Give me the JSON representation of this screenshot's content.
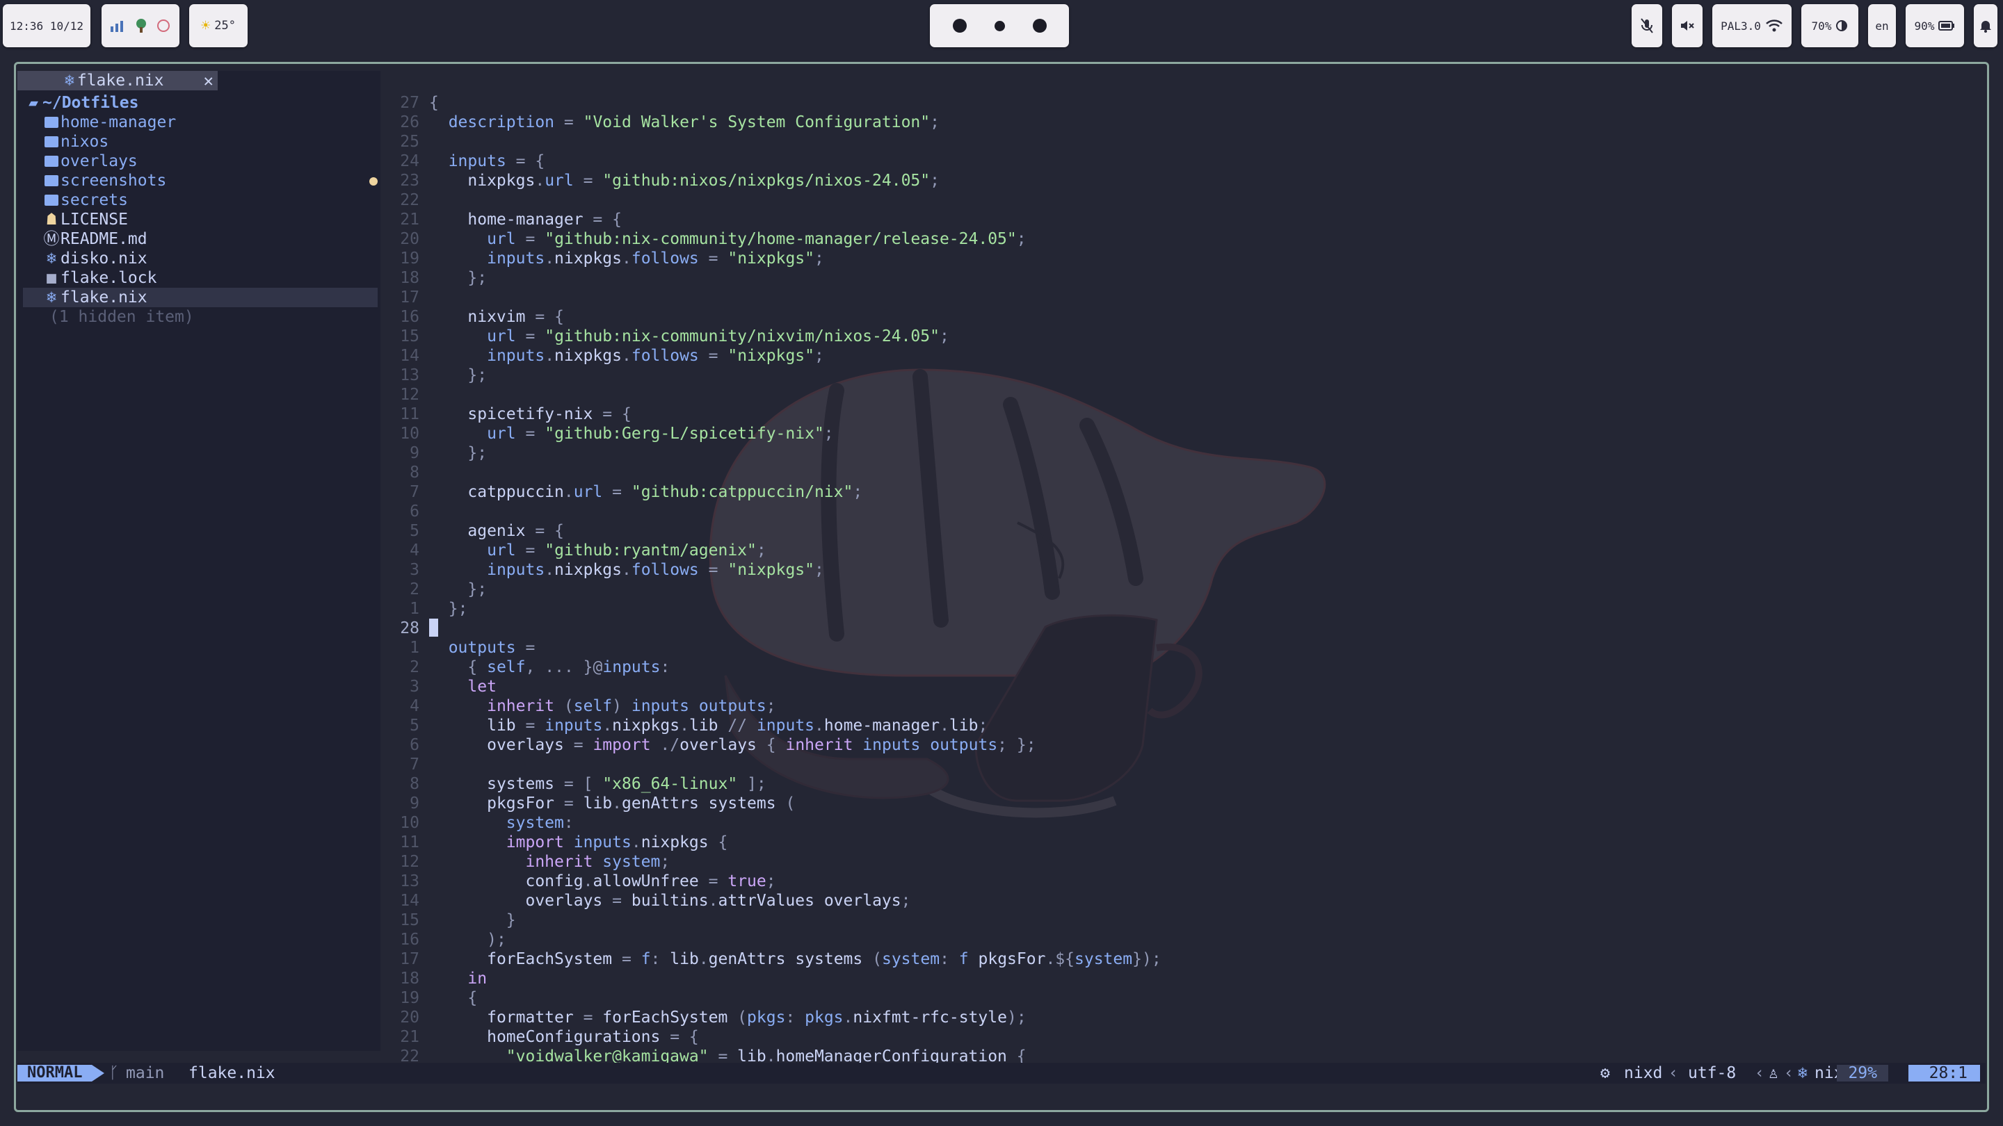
{
  "topbar": {
    "clock": "12:36 10/12",
    "weather": "25°",
    "network": "PAL3.0",
    "brightness": "70%",
    "language": "en",
    "battery": "90%"
  },
  "tab": {
    "title": "flake.nix"
  },
  "tree": [
    {
      "name": "~/Dotfiles",
      "type": "root"
    },
    {
      "name": "home-manager",
      "type": "folder"
    },
    {
      "name": "nixos",
      "type": "folder"
    },
    {
      "name": "overlays",
      "type": "folder"
    },
    {
      "name": "screenshots",
      "type": "folder",
      "modified": true
    },
    {
      "name": "secrets",
      "type": "folder"
    },
    {
      "name": "LICENSE",
      "type": "license"
    },
    {
      "name": "README.md",
      "type": "markdown"
    },
    {
      "name": "disko.nix",
      "type": "nix"
    },
    {
      "name": "flake.lock",
      "type": "lock"
    },
    {
      "name": "flake.nix",
      "type": "nix",
      "selected": true
    },
    {
      "name": "(1 hidden item)",
      "type": "hidden"
    }
  ],
  "editor": {
    "lines": [
      {
        "n": "27",
        "code": "{"
      },
      {
        "n": "26",
        "code": "  description = \"Void Walker's System Configuration\";"
      },
      {
        "n": "25",
        "code": ""
      },
      {
        "n": "24",
        "code": "  inputs = {"
      },
      {
        "n": "23",
        "code": "    nixpkgs.url = \"github:nixos/nixpkgs/nixos-24.05\";"
      },
      {
        "n": "22",
        "code": ""
      },
      {
        "n": "21",
        "code": "    home-manager = {"
      },
      {
        "n": "20",
        "code": "      url = \"github:nix-community/home-manager/release-24.05\";"
      },
      {
        "n": "19",
        "code": "      inputs.nixpkgs.follows = \"nixpkgs\";"
      },
      {
        "n": "18",
        "code": "    };"
      },
      {
        "n": "17",
        "code": ""
      },
      {
        "n": "16",
        "code": "    nixvim = {"
      },
      {
        "n": "15",
        "code": "      url = \"github:nix-community/nixvim/nixos-24.05\";"
      },
      {
        "n": "14",
        "code": "      inputs.nixpkgs.follows = \"nixpkgs\";"
      },
      {
        "n": "13",
        "code": "    };"
      },
      {
        "n": "12",
        "code": ""
      },
      {
        "n": "11",
        "code": "    spicetify-nix = {"
      },
      {
        "n": "10",
        "code": "      url = \"github:Gerg-L/spicetify-nix\";"
      },
      {
        "n": "9",
        "code": "    };"
      },
      {
        "n": "8",
        "code": ""
      },
      {
        "n": "7",
        "code": "    catppuccin.url = \"github:catppuccin/nix\";"
      },
      {
        "n": "6",
        "code": ""
      },
      {
        "n": "5",
        "code": "    agenix = {"
      },
      {
        "n": "4",
        "code": "      url = \"github:ryantm/agenix\";"
      },
      {
        "n": "3",
        "code": "      inputs.nixpkgs.follows = \"nixpkgs\";"
      },
      {
        "n": "2",
        "code": "    };"
      },
      {
        "n": "1",
        "code": "  };"
      },
      {
        "n": "28",
        "code": "",
        "current": true
      },
      {
        "n": "1",
        "code": "  outputs ="
      },
      {
        "n": "2",
        "code": "    { self, ... }@inputs:"
      },
      {
        "n": "3",
        "code": "    let"
      },
      {
        "n": "4",
        "code": "      inherit (self) inputs outputs;"
      },
      {
        "n": "5",
        "code": "      lib = inputs.nixpkgs.lib // inputs.home-manager.lib;"
      },
      {
        "n": "6",
        "code": "      overlays = import ./overlays { inherit inputs outputs; };"
      },
      {
        "n": "7",
        "code": ""
      },
      {
        "n": "8",
        "code": "      systems = [ \"x86_64-linux\" ];"
      },
      {
        "n": "9",
        "code": "      pkgsFor = lib.genAttrs systems ("
      },
      {
        "n": "10",
        "code": "        system:"
      },
      {
        "n": "11",
        "code": "        import inputs.nixpkgs {"
      },
      {
        "n": "12",
        "code": "          inherit system;"
      },
      {
        "n": "13",
        "code": "          config.allowUnfree = true;"
      },
      {
        "n": "14",
        "code": "          overlays = builtins.attrValues overlays;"
      },
      {
        "n": "15",
        "code": "        }"
      },
      {
        "n": "16",
        "code": "      );"
      },
      {
        "n": "17",
        "code": "      forEachSystem = f: lib.genAttrs systems (system: f pkgsFor.${system});"
      },
      {
        "n": "18",
        "code": "    in"
      },
      {
        "n": "19",
        "code": "    {"
      },
      {
        "n": "20",
        "code": "      formatter = forEachSystem (pkgs: pkgs.nixfmt-rfc-style);"
      },
      {
        "n": "21",
        "code": "      homeConfigurations = {"
      },
      {
        "n": "22",
        "code": "        \"voidwalker@kamigawa\" = lib.homeManagerConfiguration {"
      }
    ]
  },
  "statusline": {
    "mode": "NORMAL",
    "branch": "main",
    "file": "flake.nix",
    "lsp": "nixd",
    "encoding": "utf-8",
    "filetype": "nix",
    "percent": "29%",
    "position": "28:1"
  },
  "colors": {
    "accent": "#8aadf4",
    "background": "#242634",
    "border": "#8da89f"
  }
}
